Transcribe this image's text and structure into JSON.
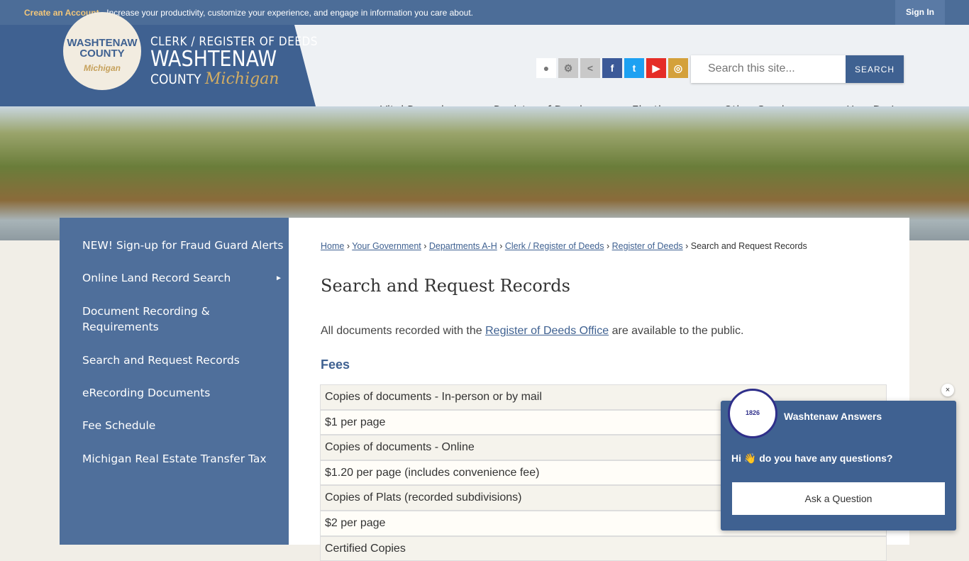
{
  "topbar": {
    "create_account": "Create an Account",
    "message": " - Increase your productivity, customize your experience, and engage in information you care about.",
    "sign_in": "Sign In"
  },
  "brand": {
    "seal_line1": "WASHTENAW",
    "seal_line2": "COUNTY",
    "seal_script": "Michigan",
    "line1": "CLERK / REGISTER OF DEEDS",
    "line2": "WASHTENAW",
    "line3": "COUNTY",
    "line3_script": "Michigan"
  },
  "social": [
    {
      "icon": "county-seal-icon",
      "glyph": "●",
      "color": "#ffffff"
    },
    {
      "icon": "gear-icon",
      "glyph": "⚙",
      "color": "#c9c9c9"
    },
    {
      "icon": "share-icon",
      "glyph": "<",
      "color": "#c9c9c9"
    },
    {
      "icon": "facebook-icon",
      "glyph": "f",
      "color": "#3b5998"
    },
    {
      "icon": "twitter-icon",
      "glyph": "t",
      "color": "#1da1f2"
    },
    {
      "icon": "youtube-icon",
      "glyph": "▶",
      "color": "#e52d27"
    },
    {
      "icon": "instagram-icon",
      "glyph": "◎",
      "color": "#d4a13b"
    }
  ],
  "search": {
    "placeholder": "Search this site...",
    "button": "SEARCH"
  },
  "nav": [
    "Vital Records",
    "Register of Deeds",
    "Elections",
    "Other Services",
    "How Do I"
  ],
  "sidebar": [
    "NEW! Sign-up for Fraud Guard Alerts",
    "Online Land Record Search",
    "Document Recording & Requirements",
    "Search and Request Records",
    "eRecording Documents",
    "Fee Schedule",
    "Michigan Real Estate Transfer Tax"
  ],
  "breadcrumb": {
    "links": [
      "Home",
      "Your Government",
      "Departments A-H",
      "Clerk / Register of Deeds",
      "Register of Deeds"
    ],
    "current": "Search and Request Records"
  },
  "page_title": "Search and Request Records",
  "intro": {
    "before": "All documents recorded with the ",
    "link": "Register of Deeds Office",
    "after": " are available to the public."
  },
  "fees_heading": "Fees",
  "fees": [
    "Copies of documents - In-person or by mail",
    "$1 per page",
    "Copies of documents - Online",
    "$1.20 per page (includes convenience fee)",
    "Copies of Plats (recorded subdivisions)",
    "$2 per page",
    "Certified Copies"
  ],
  "chat": {
    "seal_text": "1826",
    "title": "Washtenaw Answers",
    "greeting": "Hi 👋 do you have any questions?",
    "button": "Ask a Question",
    "close": "×"
  }
}
